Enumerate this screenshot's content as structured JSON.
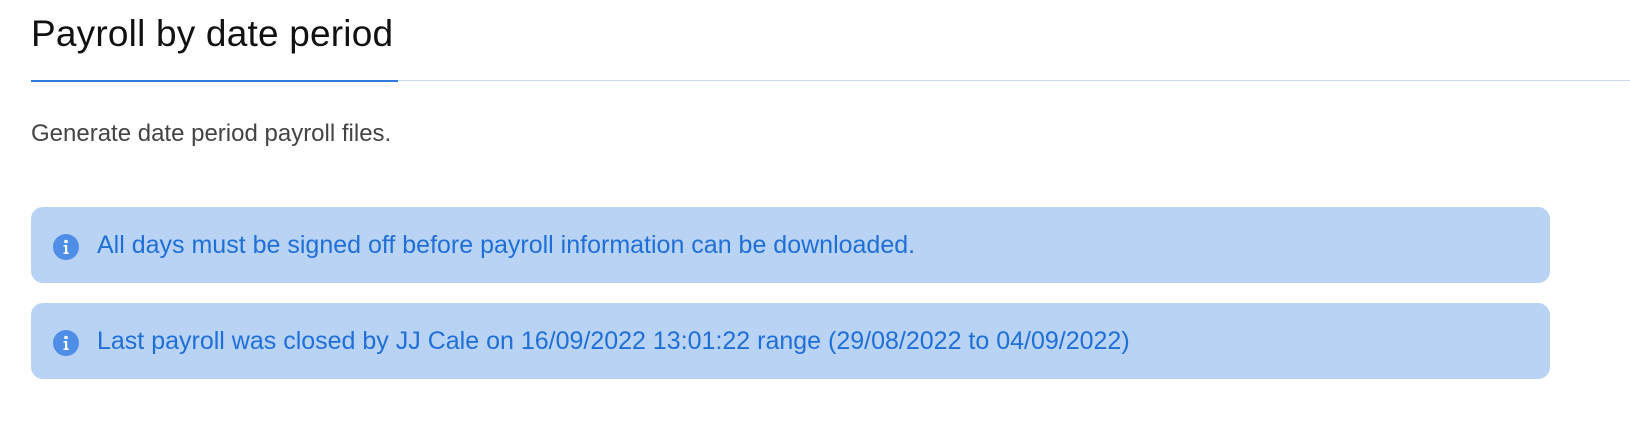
{
  "header": {
    "title": "Payroll by date period"
  },
  "main": {
    "description": "Generate date period payroll files.",
    "alerts": [
      {
        "icon": "info-icon",
        "text": "All days must be signed off before payroll information can be downloaded."
      },
      {
        "icon": "info-icon",
        "text": "Last payroll was closed by JJ Cale on 16/09/2022 13:01:22 range (29/08/2022 to 04/09/2022)"
      }
    ]
  },
  "colors": {
    "accent": "#2f7be0",
    "alert_background": "#b8d3f4",
    "alert_text": "#1f6fd6",
    "icon_fill": "#4e8ee6"
  }
}
